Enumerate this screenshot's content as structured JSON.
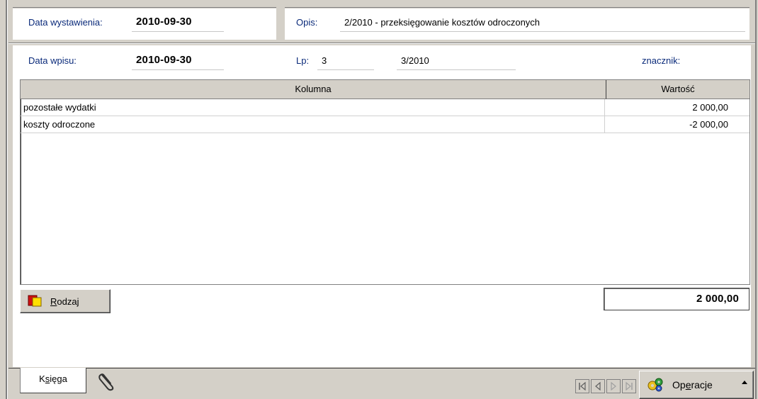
{
  "header": {
    "issue_date_label": "Data wystawienia:",
    "issue_date_value": "2010-09-30",
    "description_label": "Opis:",
    "description_value": "2/2010 - przeksięgowanie kosztów odroczonych"
  },
  "entry": {
    "entry_date_label": "Data wpisu:",
    "entry_date_value": "2010-09-30",
    "lp_label": "Lp:",
    "lp_value": "3",
    "doc_number": "3/2010",
    "marker_label": "znacznik:"
  },
  "table": {
    "columns": [
      "Kolumna",
      "Wartość"
    ],
    "rows": [
      {
        "kolumna": "pozostałe wydatki",
        "wartosc": "2 000,00"
      },
      {
        "kolumna": "koszty odroczone",
        "wartosc": "-2 000,00"
      }
    ]
  },
  "footer": {
    "rodzaj_button_prefix": "",
    "rodzaj_button_underlined": "R",
    "rodzaj_button_rest": "odzaj",
    "total_value": "2 000,00"
  },
  "tabs": {
    "ksiega_pre": "K",
    "ksiega_underlined": "s",
    "ksiega_post": "ięga"
  },
  "toolbar": {
    "operacje_pre": "Op",
    "operacje_underlined": "e",
    "operacje_post": "racje"
  },
  "icons": {
    "rodzaj": "rodzaj-icon",
    "attachment": "paperclip-icon",
    "operacje": "gears-icon",
    "nav_first": "nav-first-icon",
    "nav_prev": "nav-prev-icon",
    "nav_next": "nav-next-icon",
    "nav_last": "nav-last-icon"
  }
}
